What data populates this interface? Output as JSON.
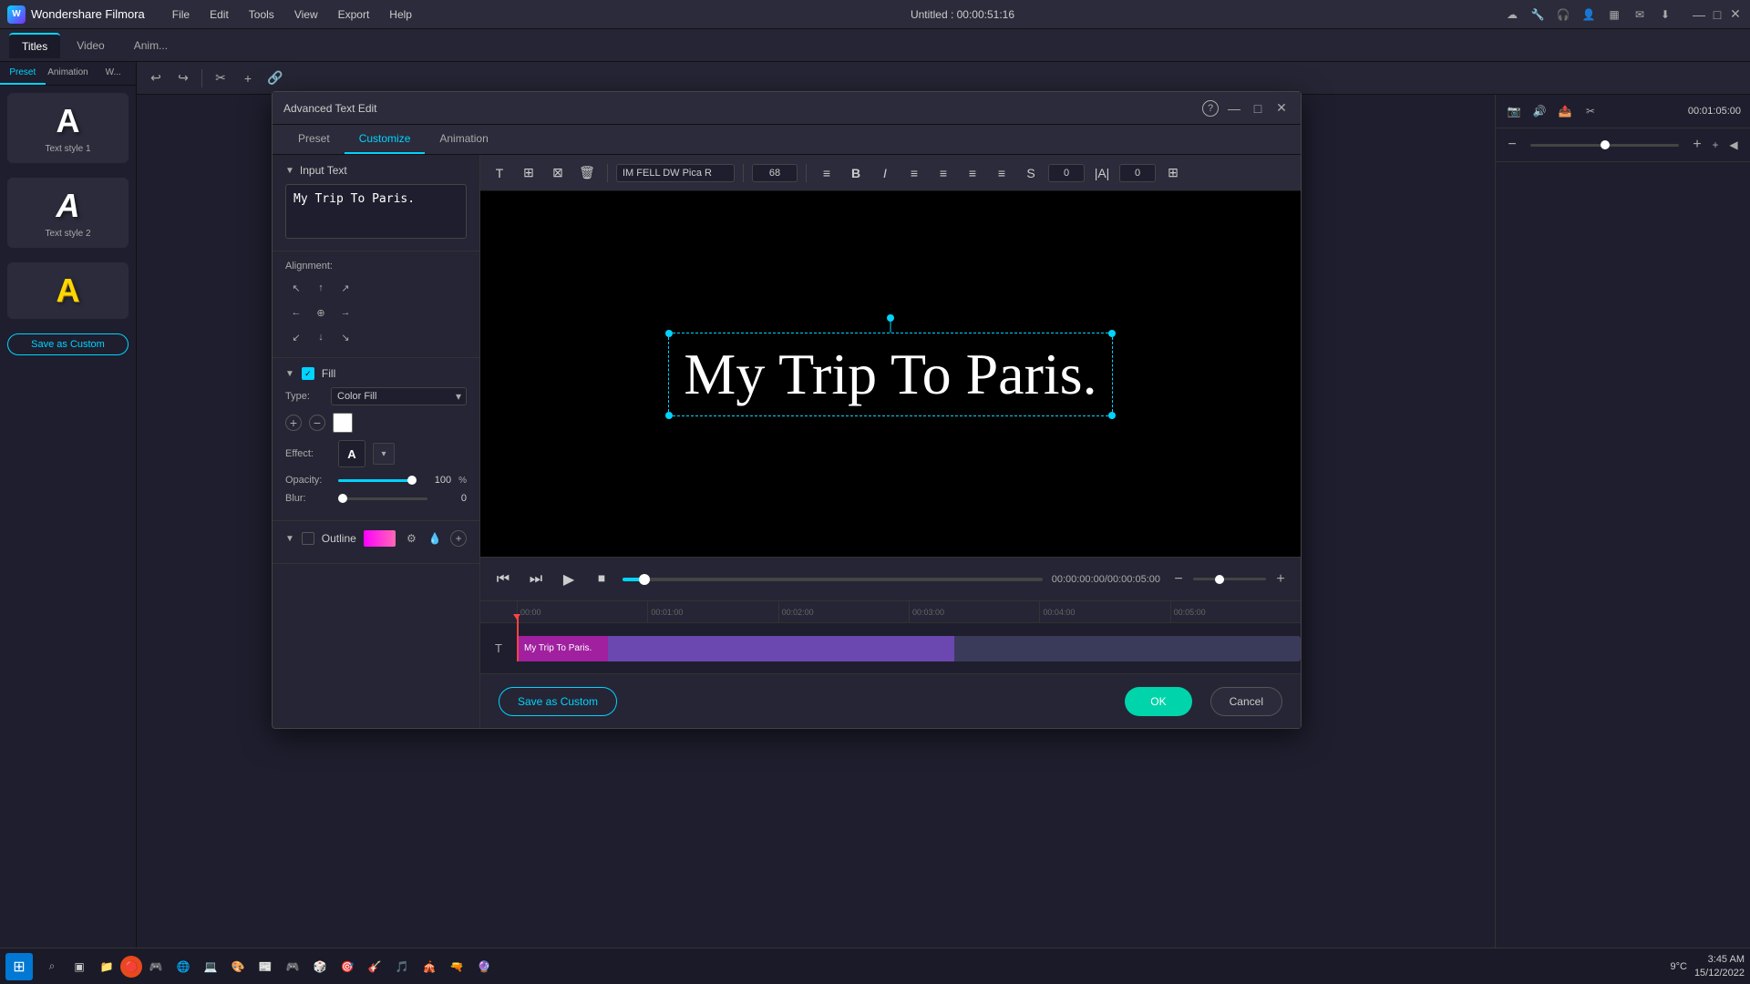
{
  "app": {
    "name": "Wondershare Filmora",
    "title": "Untitled : 00:00:51:16"
  },
  "menu": {
    "items": [
      "File",
      "Edit",
      "Tools",
      "View",
      "Export",
      "Help"
    ]
  },
  "window_controls": {
    "minimize": "—",
    "maximize": "□",
    "close": "✕"
  },
  "main_tabs": [
    "Titles",
    "Video",
    "Anim..."
  ],
  "sub_tabs": [
    "Preset",
    "Animation",
    "W..."
  ],
  "sidebar": {
    "style1_label": "Text style 1",
    "style2_label": "Text style 2",
    "save_custom_label": "Save as Custom"
  },
  "dialog": {
    "title": "Advanced Text Edit",
    "tabs": [
      "Preset",
      "Customize",
      "Animation"
    ],
    "active_tab": "Customize",
    "toolbar": {
      "font": "IM FELL DW Pica R",
      "size": "68",
      "bold": "B",
      "italic": "I"
    },
    "input_text": {
      "label": "Input Text",
      "value": "My Trip To Paris."
    },
    "alignment": {
      "label": "Alignment:"
    },
    "fill": {
      "label": "Fill",
      "type_label": "Type:",
      "type_value": "Color Fill"
    },
    "effect": {
      "label": "Effect:"
    },
    "opacity": {
      "label": "Opacity:",
      "value": "100",
      "unit": "%"
    },
    "blur": {
      "label": "Blur:",
      "value": "0"
    },
    "outline": {
      "label": "Outline"
    },
    "preview_text": "My Trip To Paris.",
    "time_display": "00:00:00:00/00:00:05:00",
    "footer": {
      "save_custom": "Save as Custom",
      "ok": "OK",
      "cancel": "Cancel"
    }
  },
  "timeline": {
    "marks": [
      "00:00",
      "00:01:00",
      "00:02:00",
      "00:03:00",
      "00:04:00",
      "00:05:00"
    ],
    "clip_text": "My Trip To Paris.",
    "timestamp_right": "00:01:05:00"
  },
  "taskbar": {
    "time": "3:45 AM",
    "date": "15/12/2022",
    "temperature": "9°C"
  }
}
